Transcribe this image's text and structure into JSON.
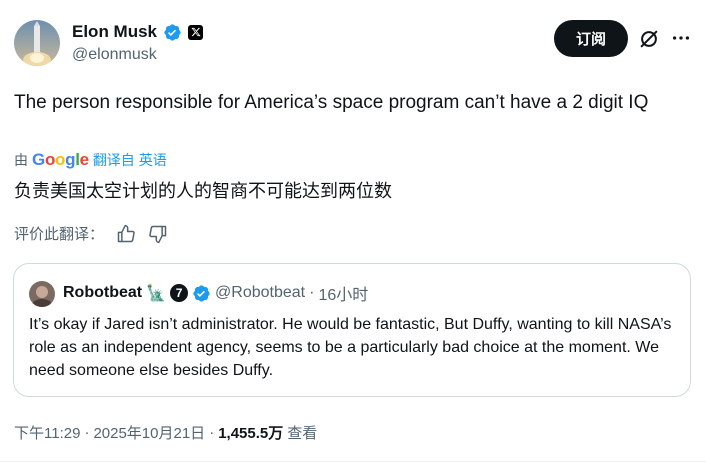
{
  "author": {
    "display_name": "Elon Musk",
    "handle": "@elonmusk",
    "verified_color": "#1d9bf0",
    "affiliate_badge_icon": "x-logo-icon"
  },
  "actions": {
    "subscribe_label": "订阅",
    "grok_icon": "grok-icon",
    "more_icon": "more-icon"
  },
  "tweet": {
    "text": "The person responsible for America’s space program can’t have a 2 digit IQ",
    "translation": {
      "by_label": "由",
      "provider": "Google",
      "link_label": "翻译自 英语",
      "text": "负责美国太空计划的人的智商不可能达到两位数"
    },
    "rate": {
      "label": "评价此翻译：",
      "thumbs_up_icon": "thumbs-up-icon",
      "thumbs_down_icon": "thumbs-down-icon"
    }
  },
  "quote": {
    "display_name": "Robotbeat",
    "name_emoji": "🗽",
    "badge_number": "7",
    "handle": "@Robotbeat",
    "separator": "·",
    "time": "16小时",
    "text": "It’s okay if Jared isn’t administrator. He would be fantastic, But Duffy, wanting to kill NASA’s role as an independent agency, seems to be a particularly bad choice at the moment. We need someone else besides Duffy."
  },
  "meta": {
    "time": "下午11:29",
    "dot1": "·",
    "date": "2025年10月21日",
    "dot2": "·",
    "views_count": "1,455.5万",
    "views_label": "查看"
  },
  "colors": {
    "accent": "#1d9bf0",
    "text_primary": "#0f1419",
    "text_secondary": "#536471",
    "border": "#cfd9de"
  }
}
